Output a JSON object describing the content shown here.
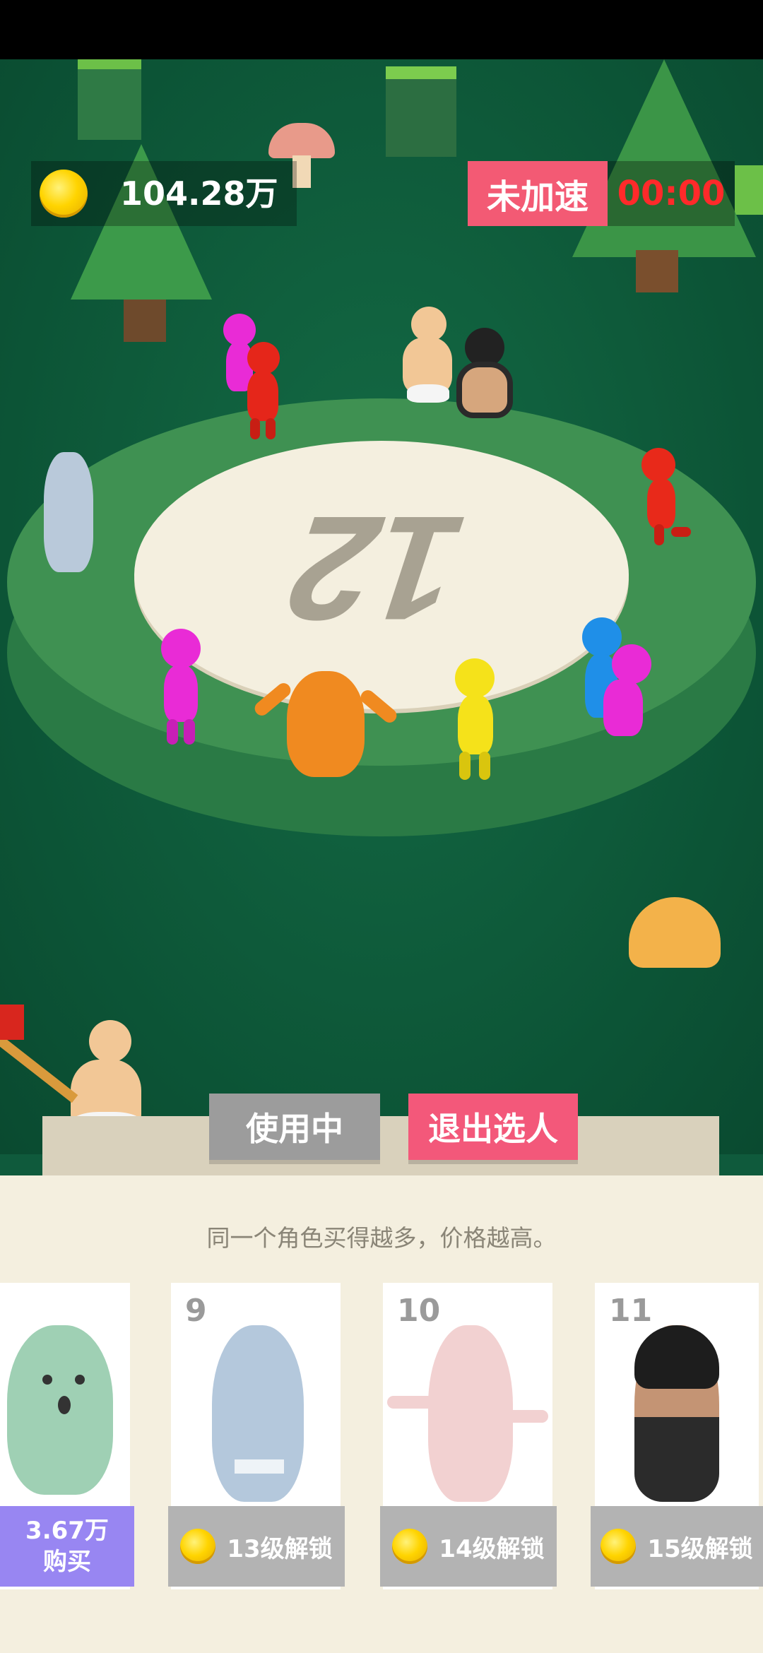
{
  "hud": {
    "coins": "104.28万",
    "coin_icon": "gold-coin-icon",
    "speed_status": "未加速",
    "timer": "00:00",
    "colors": {
      "speed_badge": "#f35a74",
      "timer_text": "#ff2a2a"
    }
  },
  "arena": {
    "round_number": "12"
  },
  "tabs": {
    "in_use": "使用中",
    "exit": "退出选人"
  },
  "shop": {
    "hint": "同一个角色买得越多，价格越高。",
    "cards": [
      {
        "level": "",
        "button_line1": "3.67万",
        "button_line2": "购买",
        "type": "buy",
        "character": "green-ghost"
      },
      {
        "level": "9",
        "button": "13级解锁",
        "type": "locked",
        "character": "blue-ghost"
      },
      {
        "level": "10",
        "button": "14级解锁",
        "type": "locked",
        "character": "pink-ghost"
      },
      {
        "level": "11",
        "button": "15级解锁",
        "type": "locked",
        "character": "masked-wrestler"
      }
    ]
  }
}
